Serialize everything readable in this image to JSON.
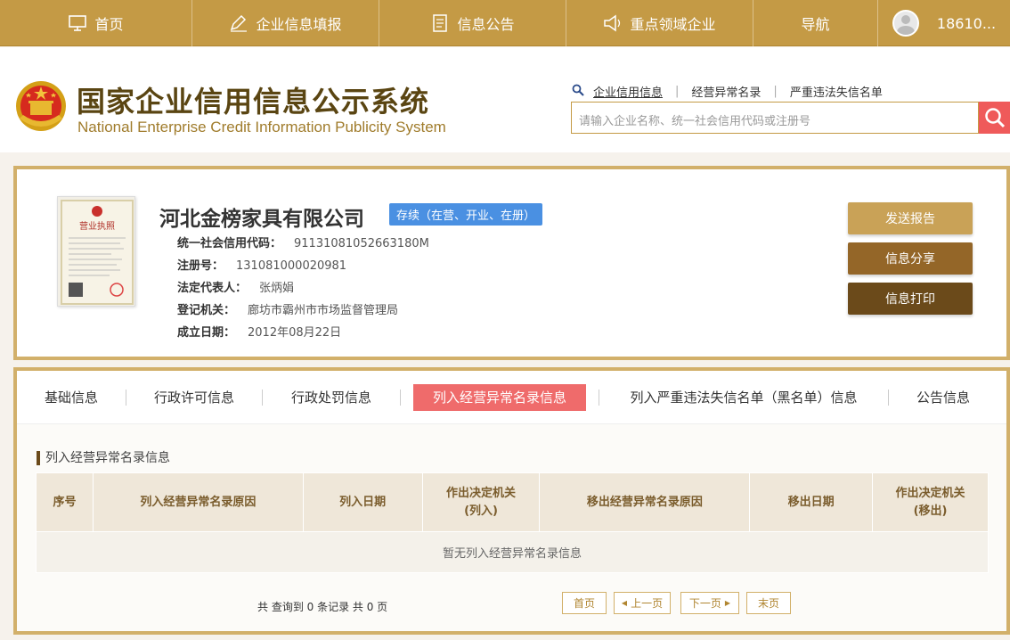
{
  "topnav": {
    "home": "首页",
    "fill_info": "企业信息填报",
    "announcement": "信息公告",
    "key_field": "重点领域企业",
    "navigation": "导航",
    "user": "18610..."
  },
  "header": {
    "title_cn": "国家企业信用信息公示系统",
    "title_en": "National Enterprise Credit Information Publicity System",
    "search_tabs": [
      "企业信用信息",
      "经营异常名录",
      "严重违法失信名单"
    ],
    "search_placeholder": "请输入企业名称、统一社会信用代码或注册号"
  },
  "company": {
    "name": "河北金榜家具有限公司",
    "status": "存续（在营、开业、在册）",
    "license_title": "营业执照",
    "fields": [
      {
        "label": "统一社会信用代码：",
        "value": "91131081052663180M"
      },
      {
        "label": "注册号：",
        "value": "131081000020981"
      },
      {
        "label": "法定代表人：",
        "value": "张炳娟"
      },
      {
        "label": "登记机关：",
        "value": "廊坊市霸州市市场监督管理局"
      },
      {
        "label": "成立日期：",
        "value": "2012年08月22日"
      }
    ],
    "buttons": {
      "send_report": "发送报告",
      "share": "信息分享",
      "print": "信息打印"
    },
    "button_colors": {
      "send_report": "#c9a257",
      "share": "#946628",
      "print": "#6b4a1a"
    }
  },
  "tabs": {
    "items": [
      "基础信息",
      "行政许可信息",
      "行政处罚信息",
      "列入经营异常名录信息",
      "列入严重违法失信名单（黑名单）信息",
      "公告信息"
    ],
    "active_index": 3
  },
  "section": {
    "title": "列入经营异常名录信息",
    "columns": [
      "序号",
      "列入经营异常名录原因",
      "列入日期",
      "作出决定机关\n(列入)",
      "移出经营异常名录原因",
      "移出日期",
      "作出决定机关\n(移出)"
    ],
    "empty_text": "暂无列入经营异常名录信息"
  },
  "pager": {
    "summary": "共 查询到 0 条记录 共 0 页",
    "first": "首页",
    "prev": "上一页",
    "next": "下一页",
    "last": "末页"
  },
  "colors": {
    "nav_bg": "#c49a45",
    "border_gold": "#d2b06a",
    "active_tab": "#ef6b6b",
    "badge_blue": "#4a90e2",
    "search_btn": "#ef5a5a"
  }
}
